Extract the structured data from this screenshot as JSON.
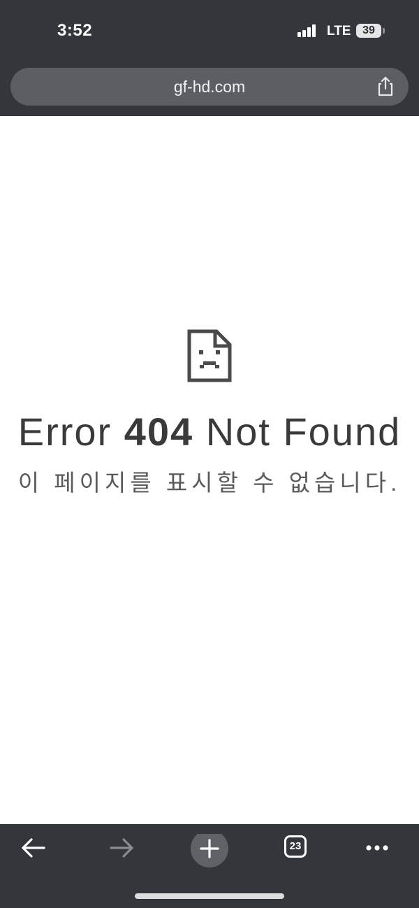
{
  "status_bar": {
    "time": "3:52",
    "network": "LTE",
    "battery": "39"
  },
  "browser": {
    "url": "gf-hd.com",
    "tab_count": "23"
  },
  "error_page": {
    "title_prefix": "Error",
    "title_code": "404",
    "title_suffix": "Not Found",
    "message": "이 페이지를 표시할 수 없습니다."
  },
  "colors": {
    "chrome_background": "#33363a",
    "url_pill": "#5b5f63",
    "page_background": "#ffffff",
    "text": "#3a3a3a"
  },
  "icons": [
    "share-icon",
    "sad-document-icon",
    "back-arrow-icon",
    "forward-arrow-icon",
    "new-tab-plus-icon",
    "tab-count-icon",
    "more-dots-icon"
  ]
}
